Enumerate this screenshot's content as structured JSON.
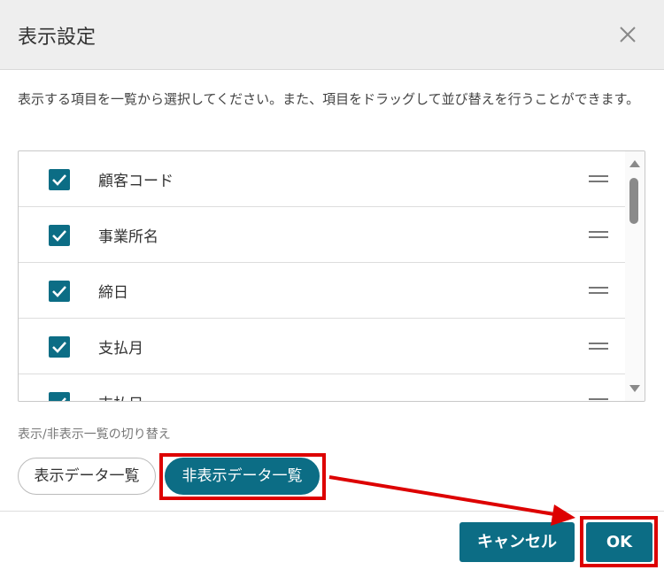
{
  "dialog": {
    "title": "表示設定",
    "description": "表示する項目を一覧から選択してください。また、項目をドラッグして並び替えを行うことができます。"
  },
  "items": [
    {
      "label": "顧客コード",
      "checked": true
    },
    {
      "label": "事業所名",
      "checked": true
    },
    {
      "label": "締日",
      "checked": true
    },
    {
      "label": "支払月",
      "checked": true
    },
    {
      "label": "支払日",
      "checked": true
    }
  ],
  "toggle": {
    "label": "表示/非表示一覧の切り替え",
    "shown_list": "表示データ一覧",
    "hidden_list": "非表示データ一覧",
    "active": "hidden_list"
  },
  "footer": {
    "cancel": "キャンセル",
    "ok": "OK"
  },
  "colors": {
    "accent": "#0c6d85",
    "highlight": "#dd0000"
  }
}
